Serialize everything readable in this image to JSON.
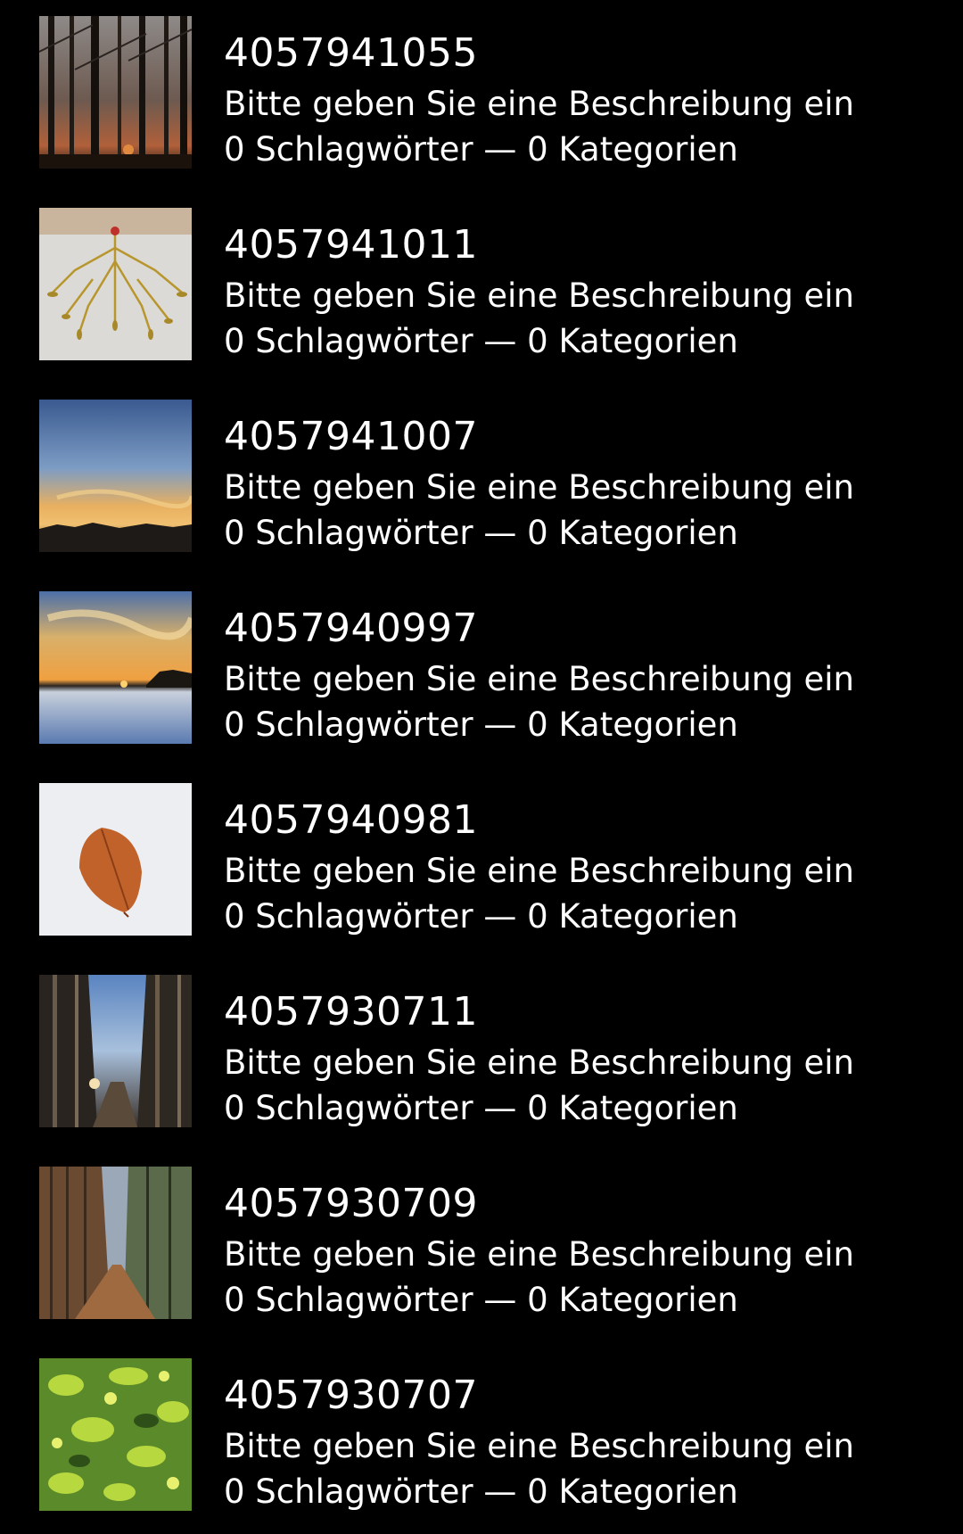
{
  "items": [
    {
      "id": "4057941055",
      "description": "Bitte geben Sie eine Beschreibung ein",
      "meta": "0 Schlagwörter — 0 Kategorien"
    },
    {
      "id": "4057941011",
      "description": "Bitte geben Sie eine Beschreibung ein",
      "meta": "0 Schlagwörter — 0 Kategorien"
    },
    {
      "id": "4057941007",
      "description": "Bitte geben Sie eine Beschreibung ein",
      "meta": "0 Schlagwörter — 0 Kategorien"
    },
    {
      "id": "4057940997",
      "description": "Bitte geben Sie eine Beschreibung ein",
      "meta": "0 Schlagwörter — 0 Kategorien"
    },
    {
      "id": "4057940981",
      "description": "Bitte geben Sie eine Beschreibung ein",
      "meta": "0 Schlagwörter — 0 Kategorien"
    },
    {
      "id": "4057930711",
      "description": "Bitte geben Sie eine Beschreibung ein",
      "meta": "0 Schlagwörter — 0 Kategorien"
    },
    {
      "id": "4057930709",
      "description": "Bitte geben Sie eine Beschreibung ein",
      "meta": "0 Schlagwörter — 0 Kategorien"
    },
    {
      "id": "4057930707",
      "description": "Bitte geben Sie eine Beschreibung ein",
      "meta": "0 Schlagwörter — 0 Kategorien"
    }
  ]
}
